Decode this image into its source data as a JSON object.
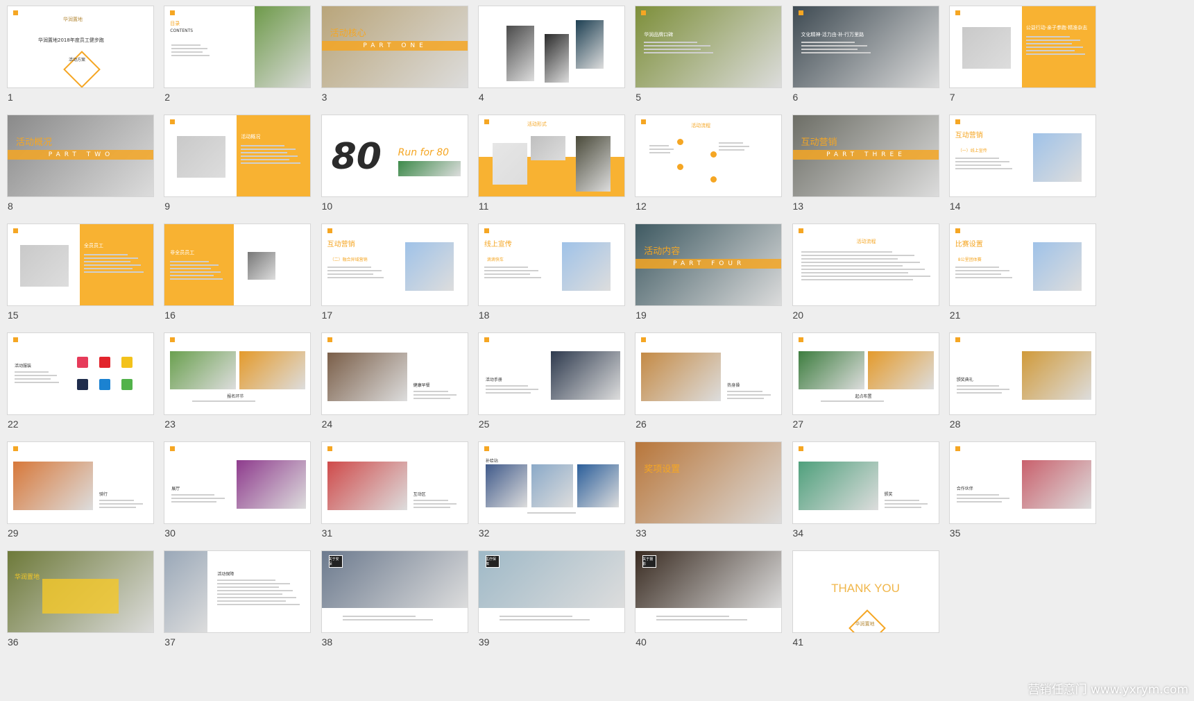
{
  "colors": {
    "accent": "#f5a623",
    "background": "#eeeeee"
  },
  "watermark": "营销任意门 www.yxrym.com",
  "slides": [
    {
      "n": "1",
      "layout": "cover",
      "title": "华润置地2018年度员工健步跑",
      "sub": "活动方案",
      "logo": "华润置地"
    },
    {
      "n": "2",
      "layout": "toc",
      "title": "目录",
      "sub": "CONTENTS"
    },
    {
      "n": "3",
      "layout": "section",
      "title": "活动核心",
      "band": "PART ONE",
      "img": "#b9a57a"
    },
    {
      "n": "4",
      "layout": "collage",
      "img": "#4a4a4a"
    },
    {
      "n": "5",
      "layout": "photo",
      "title": "华润品牌口碑",
      "img": "#7d8f3a"
    },
    {
      "n": "6",
      "layout": "photo",
      "title": "文化精神·活力由·补·行万里路",
      "img": "#3e4a52"
    },
    {
      "n": "7",
      "layout": "orangeRight",
      "title": "公益行动·亲子参跑·精准杂志"
    },
    {
      "n": "8",
      "layout": "section",
      "title": "活动概况",
      "band": "PART TWO",
      "img": "#8a8a8a"
    },
    {
      "n": "9",
      "layout": "orangeRight",
      "title": "活动概况"
    },
    {
      "n": "10",
      "layout": "big80",
      "title": "80",
      "sub": "Run for 80"
    },
    {
      "n": "11",
      "layout": "cards",
      "title": "活动形式"
    },
    {
      "n": "12",
      "layout": "flow",
      "title": "活动流程"
    },
    {
      "n": "13",
      "layout": "section",
      "title": "互动营销",
      "band": "PART THREE",
      "img": "#6d6e66"
    },
    {
      "n": "14",
      "layout": "textImg",
      "title": "互动营销",
      "sub": "（一）线上宣传"
    },
    {
      "n": "15",
      "layout": "orangeRight",
      "title": "全员员工"
    },
    {
      "n": "16",
      "layout": "orangeLeft",
      "title": "非全员员工"
    },
    {
      "n": "17",
      "layout": "textImg",
      "title": "互动营销",
      "sub": "（二）融合异域营销"
    },
    {
      "n": "18",
      "layout": "textImg",
      "title": "线上宣传",
      "sub": "滴滴快车"
    },
    {
      "n": "19",
      "layout": "section",
      "title": "活动内容",
      "band": "PART FOUR",
      "img": "#3f5a62"
    },
    {
      "n": "20",
      "layout": "table",
      "title": "活动流程"
    },
    {
      "n": "21",
      "layout": "textImg",
      "title": "比赛设置",
      "sub": "8公里团体赛"
    },
    {
      "n": "22",
      "layout": "tshirts",
      "title": "活动服装"
    },
    {
      "n": "23",
      "layout": "twoPhotos",
      "title": "报名环节",
      "img": "#6aa04f"
    },
    {
      "n": "24",
      "layout": "photoLeft",
      "title": "健康早餐",
      "img": "#7a5e48"
    },
    {
      "n": "25",
      "layout": "photoRight",
      "title": "活动手册",
      "img": "#2e3a4e"
    },
    {
      "n": "26",
      "layout": "photoLeft",
      "title": "热身操",
      "img": "#c48a45"
    },
    {
      "n": "27",
      "layout": "twoPhotos",
      "title": "起点布置",
      "img": "#3d7d3f"
    },
    {
      "n": "28",
      "layout": "photoRight",
      "title": "颁奖典礼",
      "img": "#d09a3a"
    },
    {
      "n": "29",
      "layout": "photoLeft",
      "title": "骑行",
      "img": "#d7783a"
    },
    {
      "n": "30",
      "layout": "photoRight",
      "title": "展厅",
      "img": "#8e3b8d"
    },
    {
      "n": "31",
      "layout": "photoLeft",
      "title": "互动区",
      "img": "#cf4a4a"
    },
    {
      "n": "32",
      "layout": "threePhotos",
      "title": "补给站",
      "img": "#405a8a"
    },
    {
      "n": "33",
      "layout": "section",
      "title": "奖项设置",
      "band": "",
      "img": "#b8763a"
    },
    {
      "n": "34",
      "layout": "photoLeft",
      "title": "颁奖",
      "img": "#4fa07c"
    },
    {
      "n": "35",
      "layout": "photoRight",
      "title": "合作伙伴",
      "img": "#c9606c"
    },
    {
      "n": "36",
      "layout": "photoCover",
      "title": "华润置地",
      "img": "#6e7a3a"
    },
    {
      "n": "37",
      "layout": "photoLeftText",
      "title": "活动保障",
      "img": "#9aa8b8"
    },
    {
      "n": "38",
      "layout": "photoTop",
      "title": "关于安保",
      "img": "#6c7a8e"
    },
    {
      "n": "39",
      "layout": "photoTop",
      "title": "医疗保障",
      "img": "#9fb9c7"
    },
    {
      "n": "40",
      "layout": "photoTop",
      "title": "关于摄影",
      "img": "#3a2c22"
    },
    {
      "n": "41",
      "layout": "thanks",
      "title": "THANK YOU",
      "logo": "华润置地"
    }
  ]
}
